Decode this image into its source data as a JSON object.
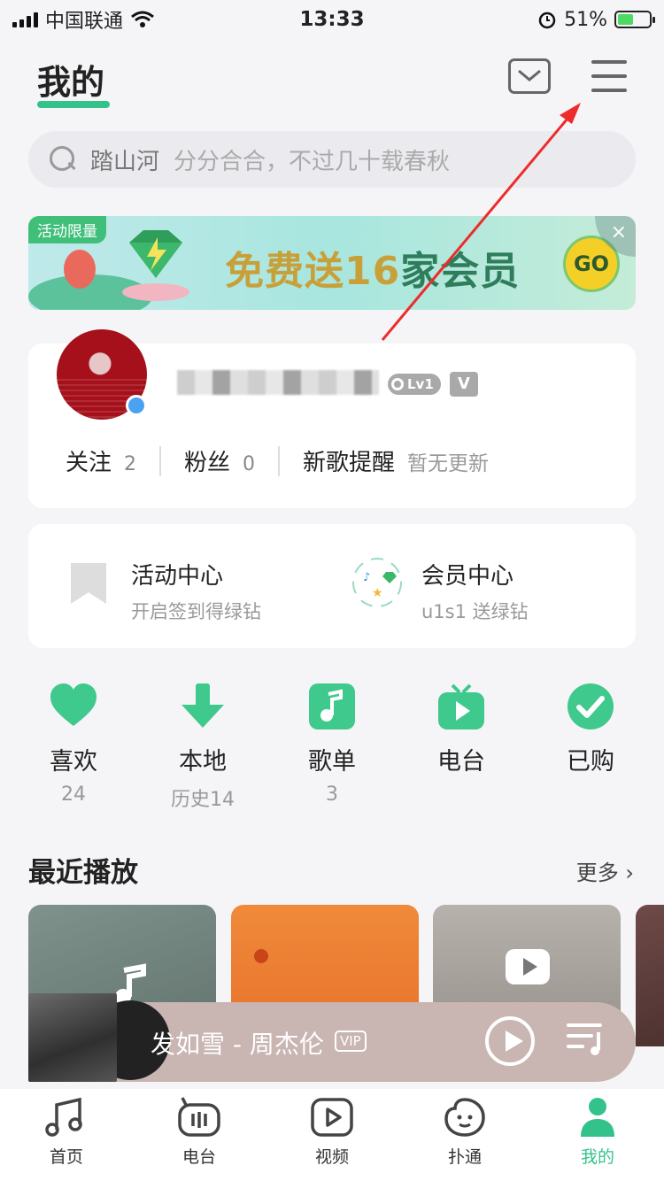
{
  "status": {
    "carrier": "中国联通",
    "time": "13:33",
    "battery": "51%",
    "battery_level": 0.51
  },
  "header": {
    "title": "我的"
  },
  "search": {
    "hot": "踏山河",
    "hint": "分分合合，不过几十载春秋"
  },
  "banner": {
    "tag": "活动限量",
    "text_part1": "免费送16",
    "text_part2": "家会员",
    "go": "GO",
    "close": "×"
  },
  "profile": {
    "level": "Lv1",
    "vip_mark": "V",
    "stats": [
      {
        "label": "关注",
        "value": "2"
      },
      {
        "label": "粉丝",
        "value": "0"
      },
      {
        "label": "新歌提醒",
        "value": "暂无更新"
      }
    ]
  },
  "entries": [
    {
      "title": "活动中心",
      "subtitle": "开启签到得绿钻"
    },
    {
      "title": "会员中心",
      "subtitle": "u1s1 送绿钻"
    }
  ],
  "quick": [
    {
      "label": "喜欢",
      "sub": "24",
      "icon": "heart-icon"
    },
    {
      "label": "本地",
      "sub": "历史14",
      "icon": "download-icon"
    },
    {
      "label": "歌单",
      "sub": "3",
      "icon": "playlist-note-icon"
    },
    {
      "label": "电台",
      "sub": "",
      "icon": "radio-tv-icon"
    },
    {
      "label": "已购",
      "sub": "",
      "icon": "check-icon"
    }
  ],
  "recent": {
    "title": "最近播放",
    "more": "更多 ›"
  },
  "player": {
    "title": "发如雪 - 周杰伦",
    "vip": "VIP"
  },
  "tabs": [
    {
      "label": "首页",
      "icon": "music-note-icon"
    },
    {
      "label": "电台",
      "icon": "radio-icon"
    },
    {
      "label": "视频",
      "icon": "video-icon"
    },
    {
      "label": "扑通",
      "icon": "chat-bubble-icon"
    },
    {
      "label": "我的",
      "icon": "profile-icon",
      "active": true
    }
  ],
  "colors": {
    "accent": "#33c38a",
    "arrow": "#ee2b2b"
  }
}
